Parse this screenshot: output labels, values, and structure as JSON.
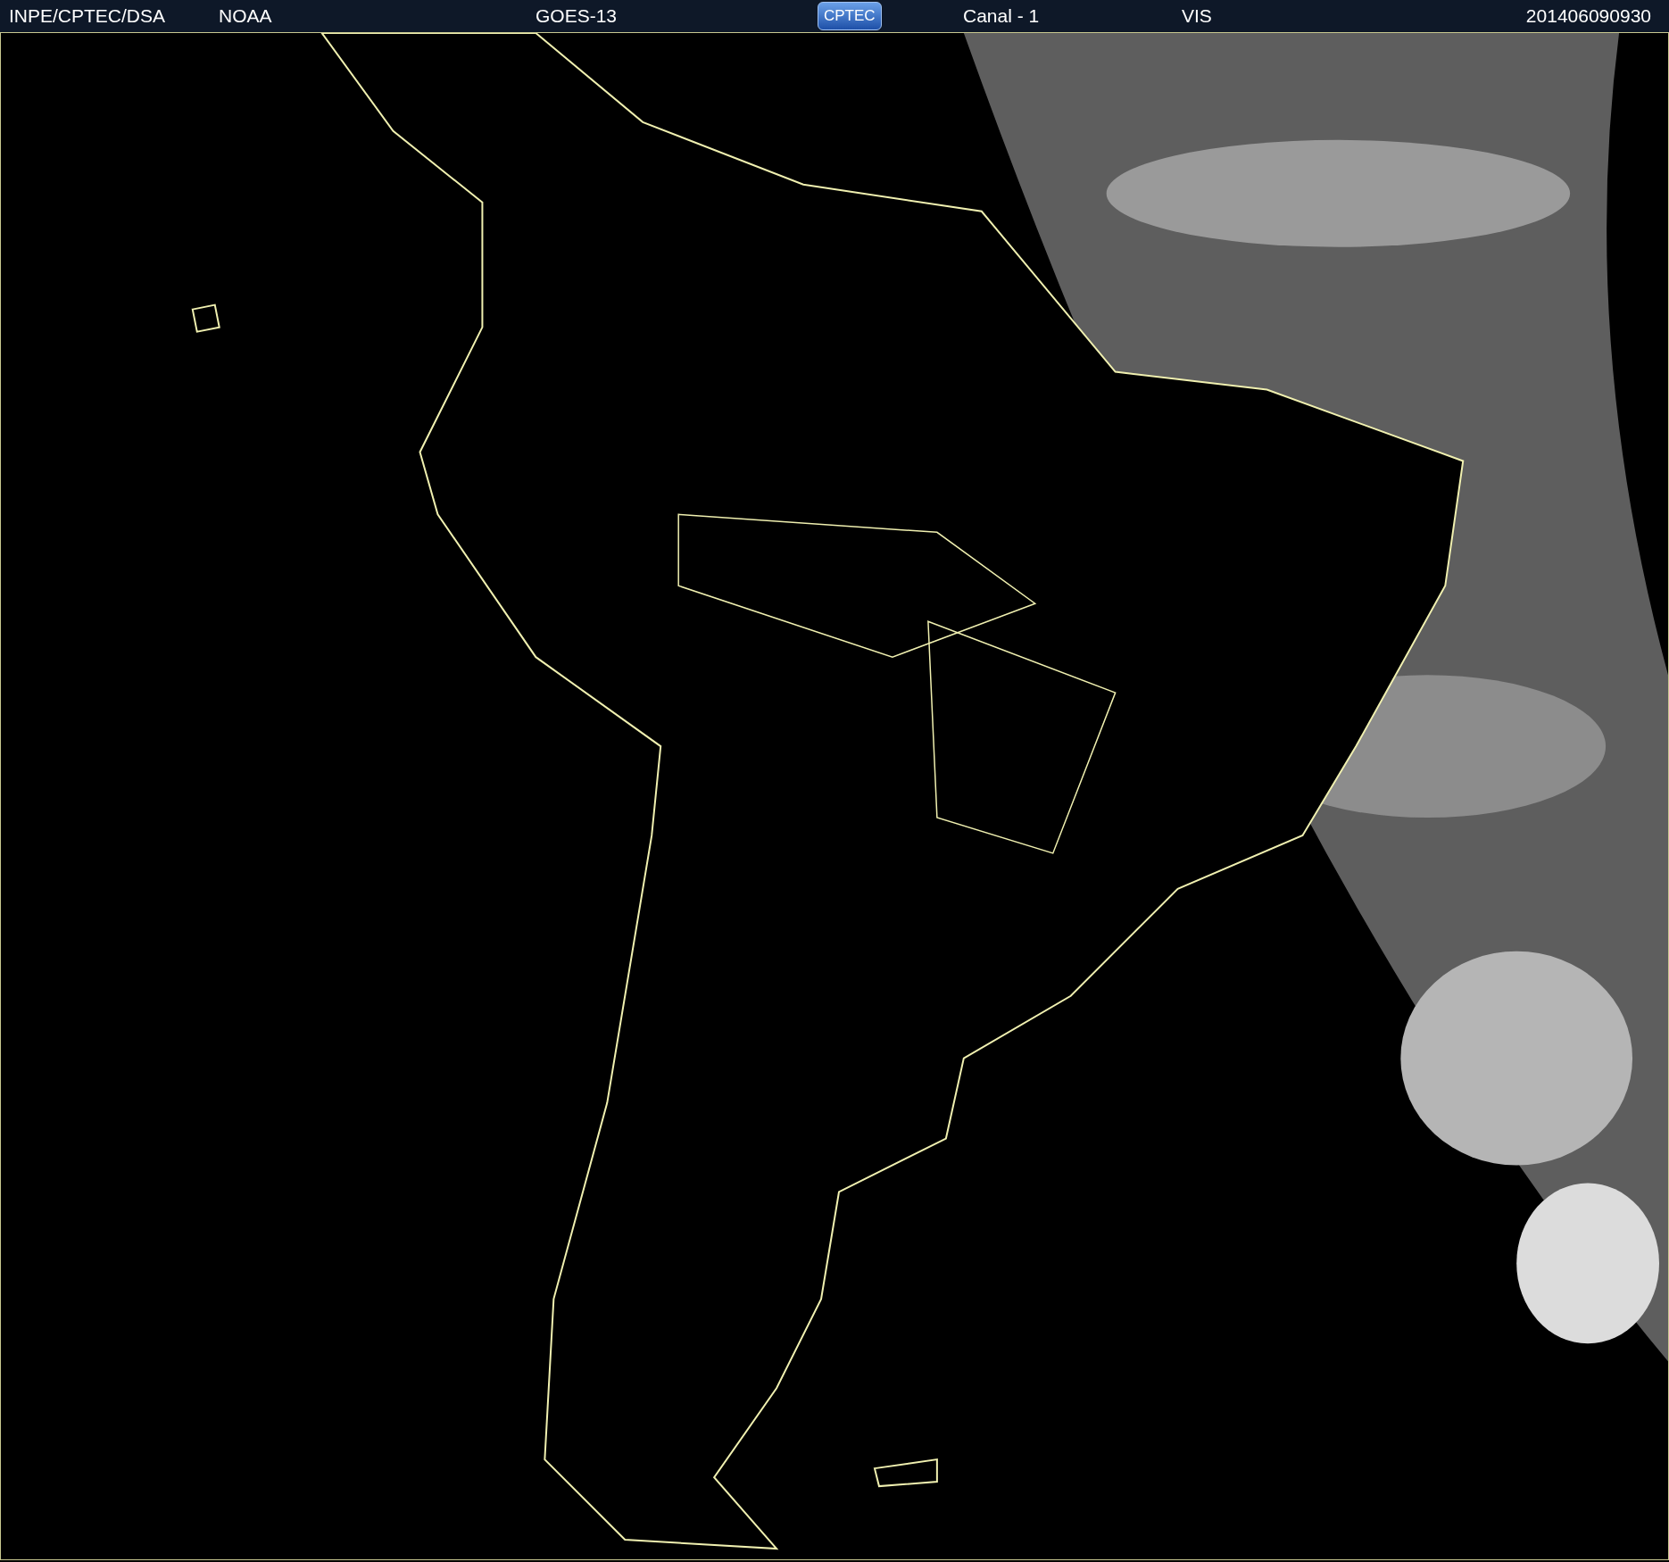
{
  "header": {
    "texts": [
      {
        "kind": "text",
        "text": "INPE/CPTEC/DSA"
      },
      {
        "kind": "text",
        "text": "NOAA"
      },
      {
        "kind": "text",
        "text": "GOES-13"
      },
      {
        "kind": "logo",
        "text": "CPTEC"
      },
      {
        "kind": "text",
        "text": "Canal - 1"
      },
      {
        "kind": "text",
        "text": "VIS"
      },
      {
        "kind": "date",
        "text": "201406090930"
      }
    ]
  }
}
